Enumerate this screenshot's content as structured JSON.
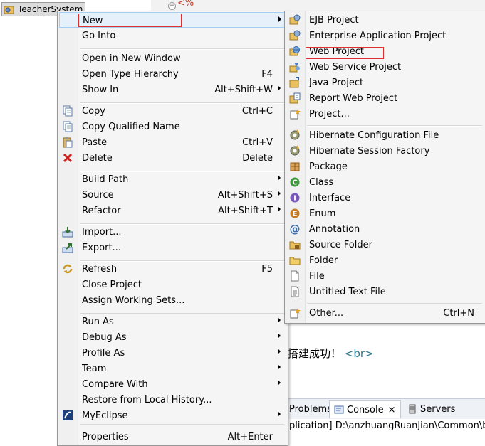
{
  "tree": {
    "project_name": "TeacherSystem"
  },
  "editor": {
    "jsp_tag": "<%",
    "text_cn": "搭建成功！",
    "text_tag": "<br>"
  },
  "console": {
    "tabs": [
      {
        "label": "Problems",
        "icon": "problems-icon"
      },
      {
        "label": "Console",
        "icon": "console-icon",
        "close": "×"
      },
      {
        "label": "Servers",
        "icon": "servers-icon"
      }
    ],
    "path": "plication] D:\\anzhuangRuanJian\\Common\\binary"
  },
  "context_menu": {
    "items": [
      {
        "label": "New",
        "shortcut": "",
        "submenu": true,
        "icon": ""
      },
      {
        "label": "Go Into",
        "shortcut": "",
        "submenu": false,
        "icon": ""
      },
      {
        "label": "Open in New Window",
        "shortcut": "",
        "submenu": false,
        "icon": ""
      },
      {
        "label": "Open Type Hierarchy",
        "shortcut": "F4",
        "submenu": false,
        "icon": ""
      },
      {
        "label": "Show In",
        "shortcut": "Alt+Shift+W",
        "submenu": true,
        "icon": ""
      },
      {
        "label": "Copy",
        "shortcut": "Ctrl+C",
        "submenu": false,
        "icon": "copy-icon"
      },
      {
        "label": "Copy Qualified Name",
        "shortcut": "",
        "submenu": false,
        "icon": "copy-qualified-name-icon"
      },
      {
        "label": "Paste",
        "shortcut": "Ctrl+V",
        "submenu": false,
        "icon": "paste-icon"
      },
      {
        "label": "Delete",
        "shortcut": "Delete",
        "submenu": false,
        "icon": "delete-icon"
      },
      {
        "label": "Build Path",
        "shortcut": "",
        "submenu": true,
        "icon": ""
      },
      {
        "label": "Source",
        "shortcut": "Alt+Shift+S",
        "submenu": true,
        "icon": ""
      },
      {
        "label": "Refactor",
        "shortcut": "Alt+Shift+T",
        "submenu": true,
        "icon": ""
      },
      {
        "label": "Import...",
        "shortcut": "",
        "submenu": false,
        "icon": "import-icon"
      },
      {
        "label": "Export...",
        "shortcut": "",
        "submenu": false,
        "icon": "export-icon"
      },
      {
        "label": "Refresh",
        "shortcut": "F5",
        "submenu": false,
        "icon": "refresh-icon"
      },
      {
        "label": "Close Project",
        "shortcut": "",
        "submenu": false,
        "icon": ""
      },
      {
        "label": "Assign Working Sets...",
        "shortcut": "",
        "submenu": false,
        "icon": ""
      },
      {
        "label": "Run As",
        "shortcut": "",
        "submenu": true,
        "icon": ""
      },
      {
        "label": "Debug As",
        "shortcut": "",
        "submenu": true,
        "icon": ""
      },
      {
        "label": "Profile As",
        "shortcut": "",
        "submenu": true,
        "icon": ""
      },
      {
        "label": "Team",
        "shortcut": "",
        "submenu": true,
        "icon": ""
      },
      {
        "label": "Compare With",
        "shortcut": "",
        "submenu": true,
        "icon": ""
      },
      {
        "label": "Restore from Local History...",
        "shortcut": "",
        "submenu": false,
        "icon": ""
      },
      {
        "label": "MyEclipse",
        "shortcut": "",
        "submenu": true,
        "icon": "myeclipse-icon"
      },
      {
        "label": "Properties",
        "shortcut": "Alt+Enter",
        "submenu": false,
        "icon": ""
      }
    ]
  },
  "new_submenu": {
    "items": [
      {
        "label": "EJB Project",
        "shortcut": "",
        "icon": "ejb-project-icon"
      },
      {
        "label": "Enterprise Application Project",
        "shortcut": "",
        "icon": "enterprise-app-project-icon"
      },
      {
        "label": "Web Project",
        "shortcut": "",
        "icon": "web-project-icon"
      },
      {
        "label": "Web Service Project",
        "shortcut": "",
        "icon": "web-service-project-icon"
      },
      {
        "label": "Java Project",
        "shortcut": "",
        "icon": "java-project-icon"
      },
      {
        "label": "Report Web Project",
        "shortcut": "",
        "icon": "report-web-project-icon"
      },
      {
        "label": "Project...",
        "shortcut": "",
        "icon": "project-icon"
      },
      {
        "label": "Hibernate Configuration File",
        "shortcut": "",
        "icon": "hibernate-config-icon"
      },
      {
        "label": "Hibernate Session Factory",
        "shortcut": "",
        "icon": "hibernate-session-icon"
      },
      {
        "label": "Package",
        "shortcut": "",
        "icon": "package-icon"
      },
      {
        "label": "Class",
        "shortcut": "",
        "icon": "class-icon"
      },
      {
        "label": "Interface",
        "shortcut": "",
        "icon": "interface-icon"
      },
      {
        "label": "Enum",
        "shortcut": "",
        "icon": "enum-icon"
      },
      {
        "label": "Annotation",
        "shortcut": "",
        "icon": "annotation-icon"
      },
      {
        "label": "Source Folder",
        "shortcut": "",
        "icon": "source-folder-icon"
      },
      {
        "label": "Folder",
        "shortcut": "",
        "icon": "folder-icon"
      },
      {
        "label": "File",
        "shortcut": "",
        "icon": "file-icon"
      },
      {
        "label": "Untitled Text File",
        "shortcut": "",
        "icon": "text-file-icon"
      },
      {
        "label": "Other...",
        "shortcut": "Ctrl+N",
        "icon": "other-icon"
      }
    ]
  }
}
